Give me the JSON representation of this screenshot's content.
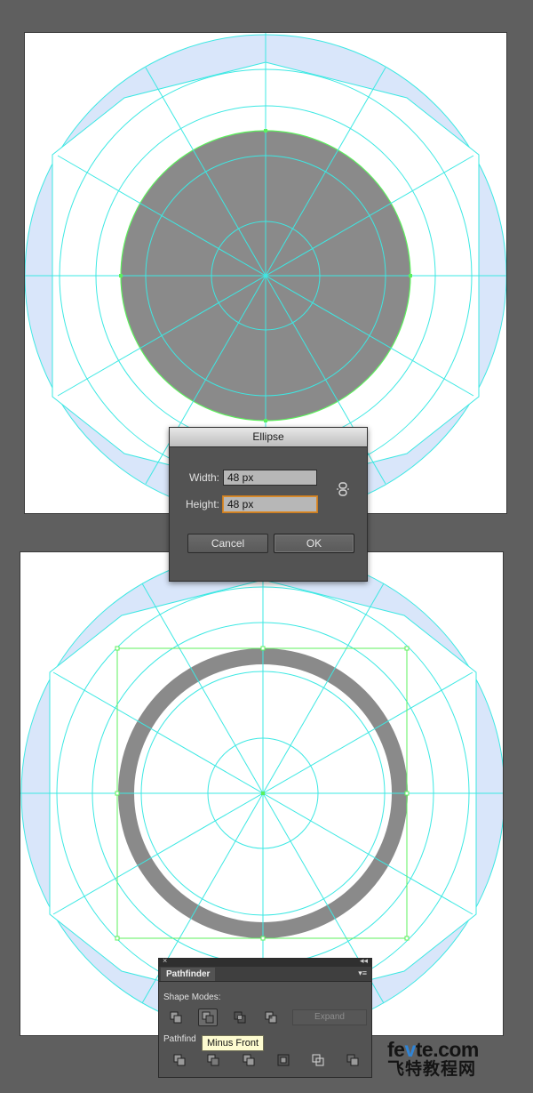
{
  "colors": {
    "background": "#5f5f5f",
    "guide": "#3de8e3",
    "guide_fill": "#d9e6fa",
    "shape_fill": "#8a8a8a",
    "selection": "#5cf05c"
  },
  "ellipse_dialog": {
    "title": "Ellipse",
    "width_label": "Width:",
    "width_value": "48 px",
    "height_label": "Height:",
    "height_value": "48 px",
    "constrain_icon": "link-icon",
    "cancel_label": "Cancel",
    "ok_label": "OK"
  },
  "pathfinder_panel": {
    "close_glyph": "×",
    "collapse_glyph": "◂◂",
    "tab_label": "Pathfinder",
    "menu_glyph": "▾≡",
    "shape_modes_label": "Shape Modes:",
    "shape_mode_icons": [
      "unite-icon",
      "minus-front-icon",
      "intersect-icon",
      "exclude-icon"
    ],
    "expand_label": "Expand",
    "pathfinders_label": "Pathfind",
    "pathfinder_icons": [
      "divide-icon",
      "trim-icon",
      "merge-icon",
      "crop-icon",
      "outline-icon",
      "minus-back-icon"
    ],
    "tooltip": "Minus Front"
  },
  "watermark": {
    "site_prefix": "fe",
    "site_accent": "v",
    "site_suffix": "te.com",
    "site_chinese": "飞特教程网"
  }
}
